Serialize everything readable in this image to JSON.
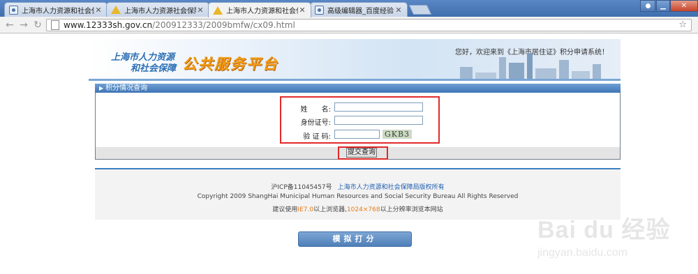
{
  "browser": {
    "tabs": [
      {
        "title": "上海市人力资源和社会保",
        "icon": "gov-site-icon",
        "active": false
      },
      {
        "title": "上海市人力资源社会保障",
        "icon": "warning-icon",
        "active": false
      },
      {
        "title": "上海市人力资源和社会保",
        "icon": "warning-icon",
        "active": true
      },
      {
        "title": "高级编辑器_百度经验",
        "icon": "gov-site-icon",
        "active": false
      }
    ],
    "url_host": "www.12333sh.gov.cn",
    "url_path": "/200912333/2009bmfw/cx09.html"
  },
  "banner": {
    "logo_line1": "上海市人力资源",
    "logo_line2": "和社会保障",
    "logo_main": "公共服务平台",
    "welcome": "您好，欢迎来到《上海市居住证》积分申请系统！"
  },
  "section": {
    "title": "积分情况查询"
  },
  "form": {
    "name_label": "姓　　名:",
    "id_label": "身份证号:",
    "captcha_label": "验 证 码:",
    "name_value": "",
    "id_value": "",
    "captcha_value": "",
    "captcha_text": "GKB3",
    "submit_label": "提交查询"
  },
  "footer": {
    "icp": "沪ICP备11045457号",
    "owner_link": "上海市人力资源和社会保障局版权所有",
    "copyright": "Copyright 2009 ShangHai Municipal Human Resources and Social Security Bureau All Rights Reserved",
    "advice_pre": "建议使用",
    "advice_browser": "IE7.0",
    "advice_mid": "以上浏览器,",
    "advice_res": "1024×768",
    "advice_post": "以上分辨率浏览本网站"
  },
  "score_button": "模拟打分",
  "watermark": {
    "logo": "Bai du 经验",
    "url": "jingyan.baidu.com"
  },
  "colors": {
    "accent_blue": "#3e75b6",
    "highlight_red": "#e12a2a",
    "logo_orange": "#f39c12"
  }
}
